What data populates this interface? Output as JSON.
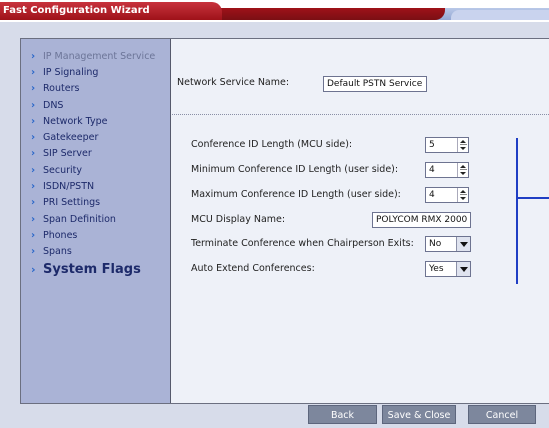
{
  "window": {
    "title": "Fast Configuration Wizard"
  },
  "sidebar": {
    "items": [
      {
        "label": "IP Management Service",
        "state": "disabled"
      },
      {
        "label": "IP Signaling",
        "state": "normal"
      },
      {
        "label": "Routers",
        "state": "normal"
      },
      {
        "label": "DNS",
        "state": "normal"
      },
      {
        "label": "Network Type",
        "state": "normal"
      },
      {
        "label": "Gatekeeper",
        "state": "normal"
      },
      {
        "label": "SIP Server",
        "state": "normal"
      },
      {
        "label": "Security",
        "state": "normal"
      },
      {
        "label": "ISDN/PSTN",
        "state": "normal"
      },
      {
        "label": "PRI Settings",
        "state": "normal"
      },
      {
        "label": "Span Definition",
        "state": "normal"
      },
      {
        "label": "Phones",
        "state": "normal"
      },
      {
        "label": "Spans",
        "state": "normal"
      },
      {
        "label": "System Flags",
        "state": "active"
      }
    ]
  },
  "form": {
    "network_service_name": {
      "label": "Network Service Name:",
      "value": "Default PSTN Service"
    },
    "conference_id_length": {
      "label": "Conference ID Length (MCU side):",
      "value": "5"
    },
    "min_conference_id_length": {
      "label": "Minimum Conference ID Length (user side):",
      "value": "4"
    },
    "max_conference_id_length": {
      "label": "Maximum Conference ID Length (user side):",
      "value": "4"
    },
    "mcu_display_name": {
      "label": "MCU Display Name:",
      "value": "POLYCOM RMX 2000"
    },
    "terminate_conference": {
      "label": "Terminate Conference when Chairperson Exits:",
      "value": "No"
    },
    "auto_extend": {
      "label": "Auto Extend Conferences:",
      "value": "Yes"
    }
  },
  "buttons": {
    "back": "Back",
    "save_close": "Save & Close",
    "cancel": "Cancel"
  },
  "colors": {
    "title_red": "#b0222a",
    "sidebar_bg": "#aab3d6",
    "accent_blue": "#1f3ec4",
    "button_gray": "#7d879d"
  }
}
